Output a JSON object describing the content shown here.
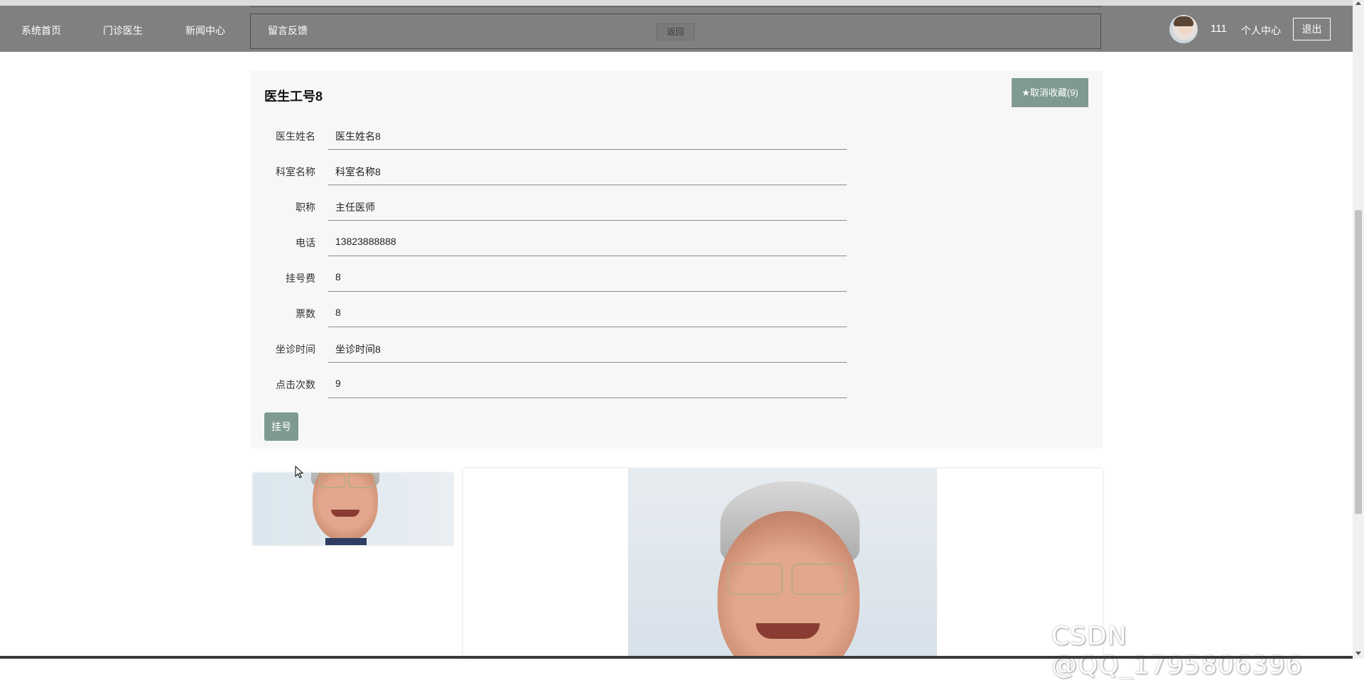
{
  "nav": {
    "items": [
      {
        "label": "系统首页"
      },
      {
        "label": "门诊医生"
      },
      {
        "label": "新闻中心"
      },
      {
        "label": "留言反馈"
      }
    ],
    "back_label": "返回",
    "user_name": "111",
    "profile_label": "个人中心",
    "logout_label": "退出"
  },
  "detail": {
    "title": "医生工号8",
    "favorite_label": "★取消收藏(9)",
    "fields": [
      {
        "label": "医生姓名",
        "value": "医生姓名8"
      },
      {
        "label": "科室名称",
        "value": "科室名称8"
      },
      {
        "label": "职称",
        "value": "主任医师"
      },
      {
        "label": "电话",
        "value": "13823888888"
      },
      {
        "label": "挂号费",
        "value": "8"
      },
      {
        "label": "票数",
        "value": "8"
      },
      {
        "label": "坐诊时间",
        "value": "坐诊时间8"
      },
      {
        "label": "点击次数",
        "value": "9"
      }
    ],
    "register_label": "挂号"
  },
  "watermark": "CSDN @QQ_1795806396",
  "colors": {
    "nav_bg": "#808080",
    "accent": "#7f9b90",
    "card_bg": "#f7f7f7"
  }
}
